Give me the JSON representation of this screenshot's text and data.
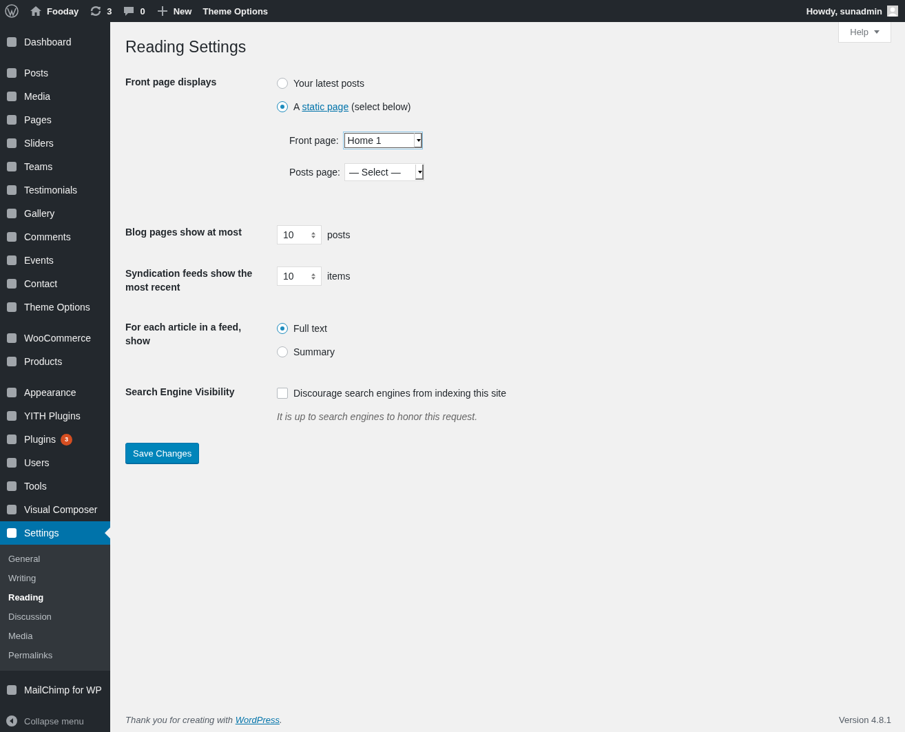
{
  "admin_bar": {
    "site": "Fooday",
    "updates": "3",
    "comments": "0",
    "new": "New",
    "theme_options": "Theme Options",
    "greeting": "Howdy, sunadmin"
  },
  "menu_groups": [
    [
      {
        "label": "Dashboard",
        "selected": false
      }
    ],
    [
      {
        "label": "Posts",
        "selected": false
      },
      {
        "label": "Media",
        "selected": false
      },
      {
        "label": "Pages",
        "selected": false
      },
      {
        "label": "Sliders",
        "selected": false
      },
      {
        "label": "Teams",
        "selected": false
      },
      {
        "label": "Testimonials",
        "selected": false
      },
      {
        "label": "Gallery",
        "selected": false
      },
      {
        "label": "Comments",
        "selected": false
      },
      {
        "label": "Events",
        "selected": false
      },
      {
        "label": "Contact",
        "selected": false
      },
      {
        "label": "Theme Options",
        "selected": false
      }
    ],
    [
      {
        "label": "WooCommerce",
        "selected": false
      },
      {
        "label": "Products",
        "selected": false
      }
    ],
    [
      {
        "label": "Appearance",
        "selected": false
      },
      {
        "label": "YITH Plugins",
        "selected": false
      },
      {
        "label": "Plugins",
        "selected": false,
        "badge": "3"
      },
      {
        "label": "Users",
        "selected": false
      },
      {
        "label": "Tools",
        "selected": false
      },
      {
        "label": "Visual Composer",
        "selected": false
      },
      {
        "label": "Settings",
        "selected": true,
        "children": [
          {
            "label": "General",
            "selected": false
          },
          {
            "label": "Writing",
            "selected": false
          },
          {
            "label": "Reading",
            "selected": true
          },
          {
            "label": "Discussion",
            "selected": false
          },
          {
            "label": "Media",
            "selected": false
          },
          {
            "label": "Permalinks",
            "selected": false
          }
        ]
      }
    ],
    [
      {
        "label": "MailChimp for WP",
        "selected": false
      }
    ]
  ],
  "collapse": "Collapse menu",
  "help": "Help",
  "title": "Reading Settings",
  "settings": [
    {
      "kind": "radio",
      "label": "Front page displays",
      "options": [
        {
          "text": "Your latest posts",
          "selected": false
        },
        {
          "text": "A ",
          "link": "static page",
          "after": " (select below)",
          "selected": true
        }
      ],
      "selects": [
        {
          "label": "Front page:",
          "value": "Home 1",
          "focused": true
        },
        {
          "label": "Posts page:",
          "value": "— Select —",
          "focused": false
        }
      ]
    },
    {
      "kind": "number",
      "label": "Blog pages show at most",
      "value": "10",
      "unit": "posts"
    },
    {
      "kind": "number",
      "label": "Syndication feeds show the most recent",
      "value": "10",
      "unit": "items"
    },
    {
      "kind": "radio",
      "label": "For each article in a feed, show",
      "options": [
        {
          "text": "Full text",
          "selected": true
        },
        {
          "text": "Summary",
          "selected": false
        }
      ]
    },
    {
      "kind": "checkbox",
      "label": "Search Engine Visibility",
      "text": "Discourage search engines from indexing this site",
      "checked": false,
      "description": "It is up to search engines to honor this request."
    }
  ],
  "save": "Save Changes",
  "footer": {
    "text": "Thank you for creating with ",
    "link": "WordPress",
    "after": ".",
    "version": "Version 4.8.1"
  }
}
